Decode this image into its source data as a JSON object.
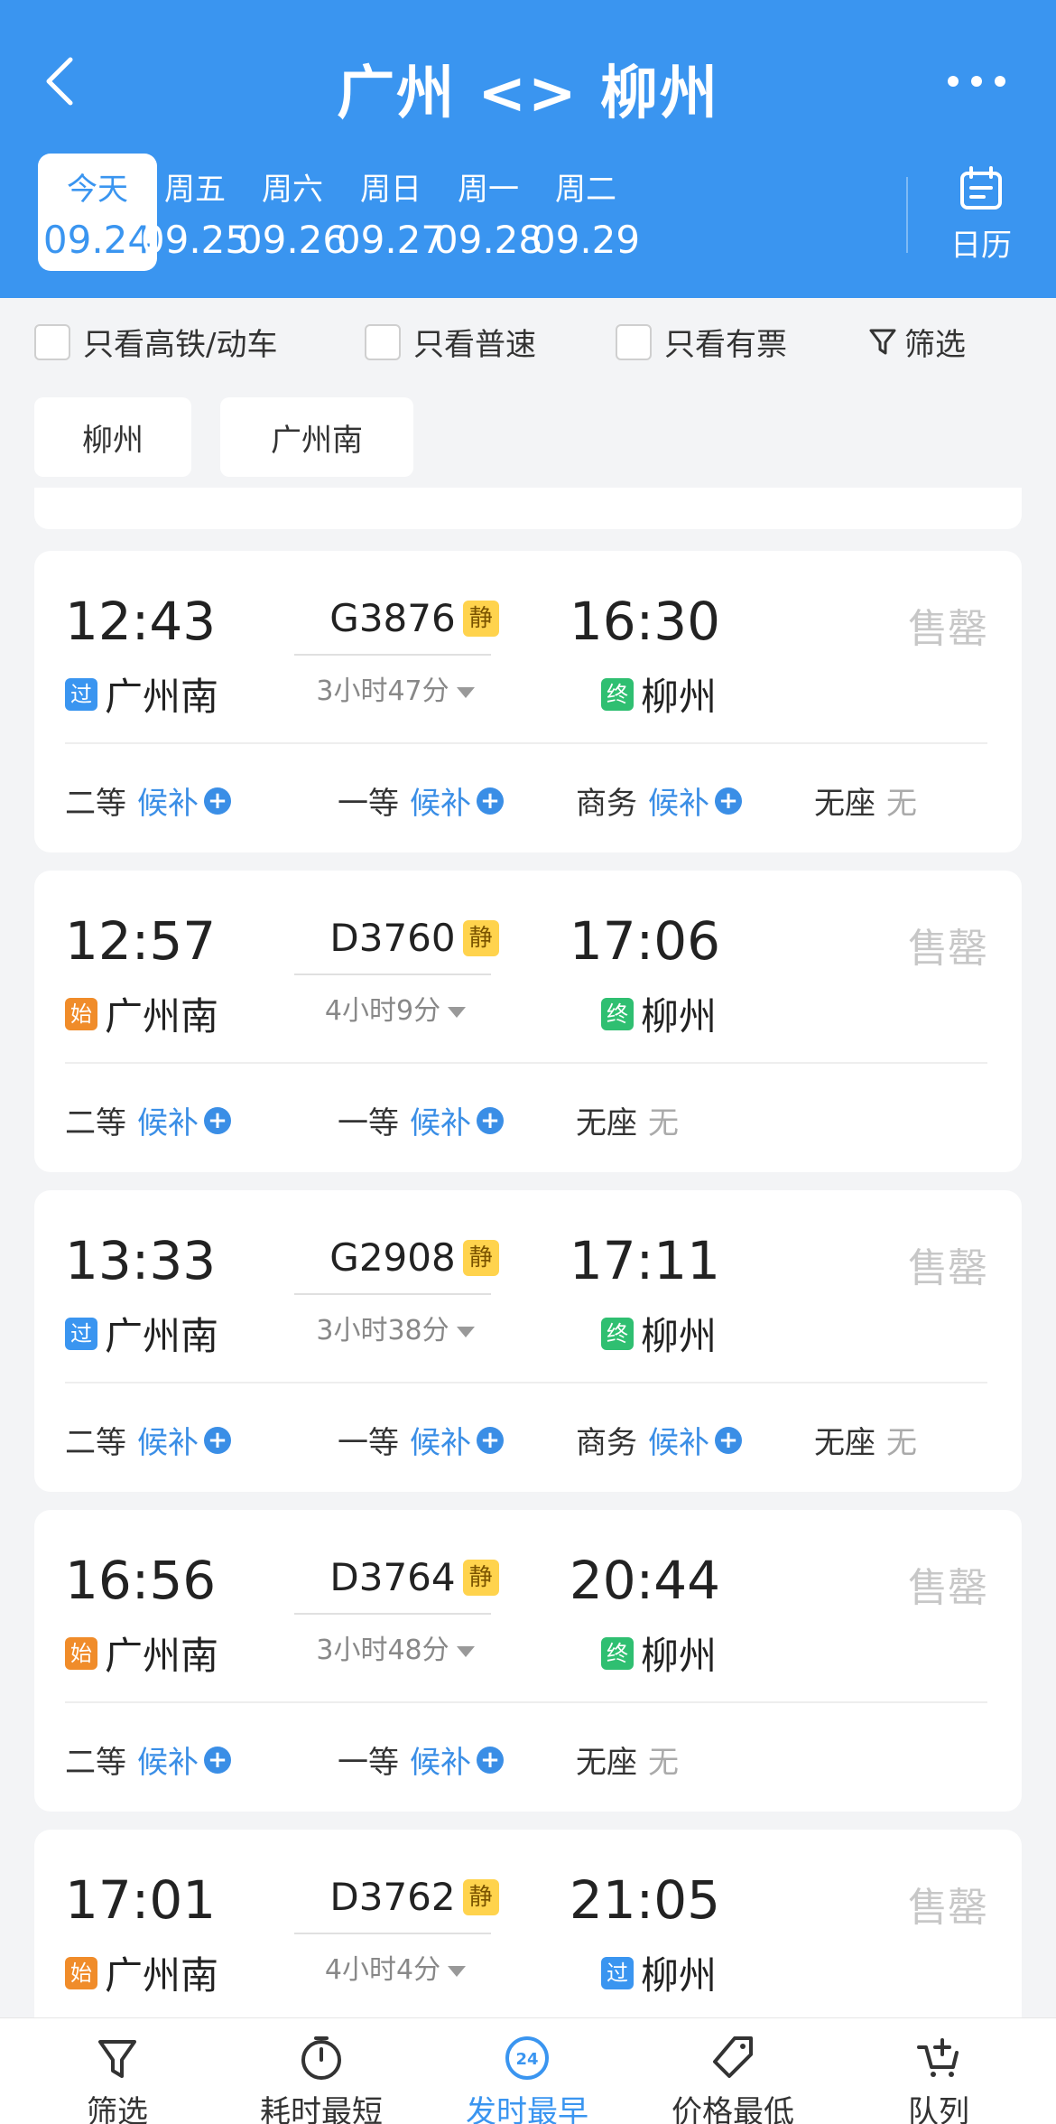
{
  "header": {
    "title": "广州 <> 柳州",
    "dates": [
      {
        "weekday": "今天",
        "date": "09.24",
        "active": true
      },
      {
        "weekday": "周五",
        "date": "09.25"
      },
      {
        "weekday": "周六",
        "date": "09.26"
      },
      {
        "weekday": "周日",
        "date": "09.27"
      },
      {
        "weekday": "周一",
        "date": "09.28"
      },
      {
        "weekday": "周二",
        "date": "09.29"
      }
    ],
    "calendar_label": "日历"
  },
  "filters": {
    "high_speed": "只看高铁/动车",
    "normal": "只看普速",
    "available": "只看有票",
    "filter": "筛选"
  },
  "stations": [
    "柳州",
    "广州南"
  ],
  "trains": [
    {
      "dep_time": "12:43",
      "dep_tag": "过",
      "dep_station": "广州南",
      "train_no": "G3876",
      "quiet": "静",
      "duration": "3小时47分",
      "arr_time": "16:30",
      "arr_tag": "终",
      "arr_station": "柳州",
      "status": "售罄",
      "seats": [
        {
          "name": "二等",
          "status": "候补"
        },
        {
          "name": "一等",
          "status": "候补"
        },
        {
          "name": "商务",
          "status": "候补"
        },
        {
          "name": "无座",
          "status": "无"
        }
      ]
    },
    {
      "dep_time": "12:57",
      "dep_tag": "始",
      "dep_station": "广州南",
      "train_no": "D3760",
      "quiet": "静",
      "duration": "4小时9分",
      "arr_time": "17:06",
      "arr_tag": "终",
      "arr_station": "柳州",
      "status": "售罄",
      "seats": [
        {
          "name": "二等",
          "status": "候补"
        },
        {
          "name": "一等",
          "status": "候补"
        },
        {
          "name": "无座",
          "status": "无"
        }
      ]
    },
    {
      "dep_time": "13:33",
      "dep_tag": "过",
      "dep_station": "广州南",
      "train_no": "G2908",
      "quiet": "静",
      "duration": "3小时38分",
      "arr_time": "17:11",
      "arr_tag": "终",
      "arr_station": "柳州",
      "status": "售罄",
      "seats": [
        {
          "name": "二等",
          "status": "候补"
        },
        {
          "name": "一等",
          "status": "候补"
        },
        {
          "name": "商务",
          "status": "候补"
        },
        {
          "name": "无座",
          "status": "无"
        }
      ]
    },
    {
      "dep_time": "16:56",
      "dep_tag": "始",
      "dep_station": "广州南",
      "train_no": "D3764",
      "quiet": "静",
      "duration": "3小时48分",
      "arr_time": "20:44",
      "arr_tag": "终",
      "arr_station": "柳州",
      "status": "售罄",
      "seats": [
        {
          "name": "二等",
          "status": "候补"
        },
        {
          "name": "一等",
          "status": "候补"
        },
        {
          "name": "无座",
          "status": "无"
        }
      ]
    },
    {
      "dep_time": "17:01",
      "dep_tag": "始",
      "dep_station": "广州南",
      "train_no": "D3762",
      "quiet": "静",
      "duration": "4小时4分",
      "arr_time": "21:05",
      "arr_tag": "过",
      "arr_station": "柳州",
      "status": "售罄",
      "seats": []
    }
  ],
  "bottom_nav": [
    {
      "label": "筛选",
      "icon": "filter-icon"
    },
    {
      "label": "耗时最短",
      "icon": "stopwatch-icon"
    },
    {
      "label": "发时最早",
      "icon": "clock-24-icon",
      "active": true
    },
    {
      "label": "价格最低",
      "icon": "price-tag-icon"
    },
    {
      "label": "队列",
      "icon": "cart-icon"
    }
  ],
  "colors": {
    "primary": "#3a95f0",
    "pass_tag": "#3a95f0",
    "start_tag": "#f08c2a",
    "end_tag": "#2fbf71",
    "quiet_tag": "#ffd34d"
  }
}
